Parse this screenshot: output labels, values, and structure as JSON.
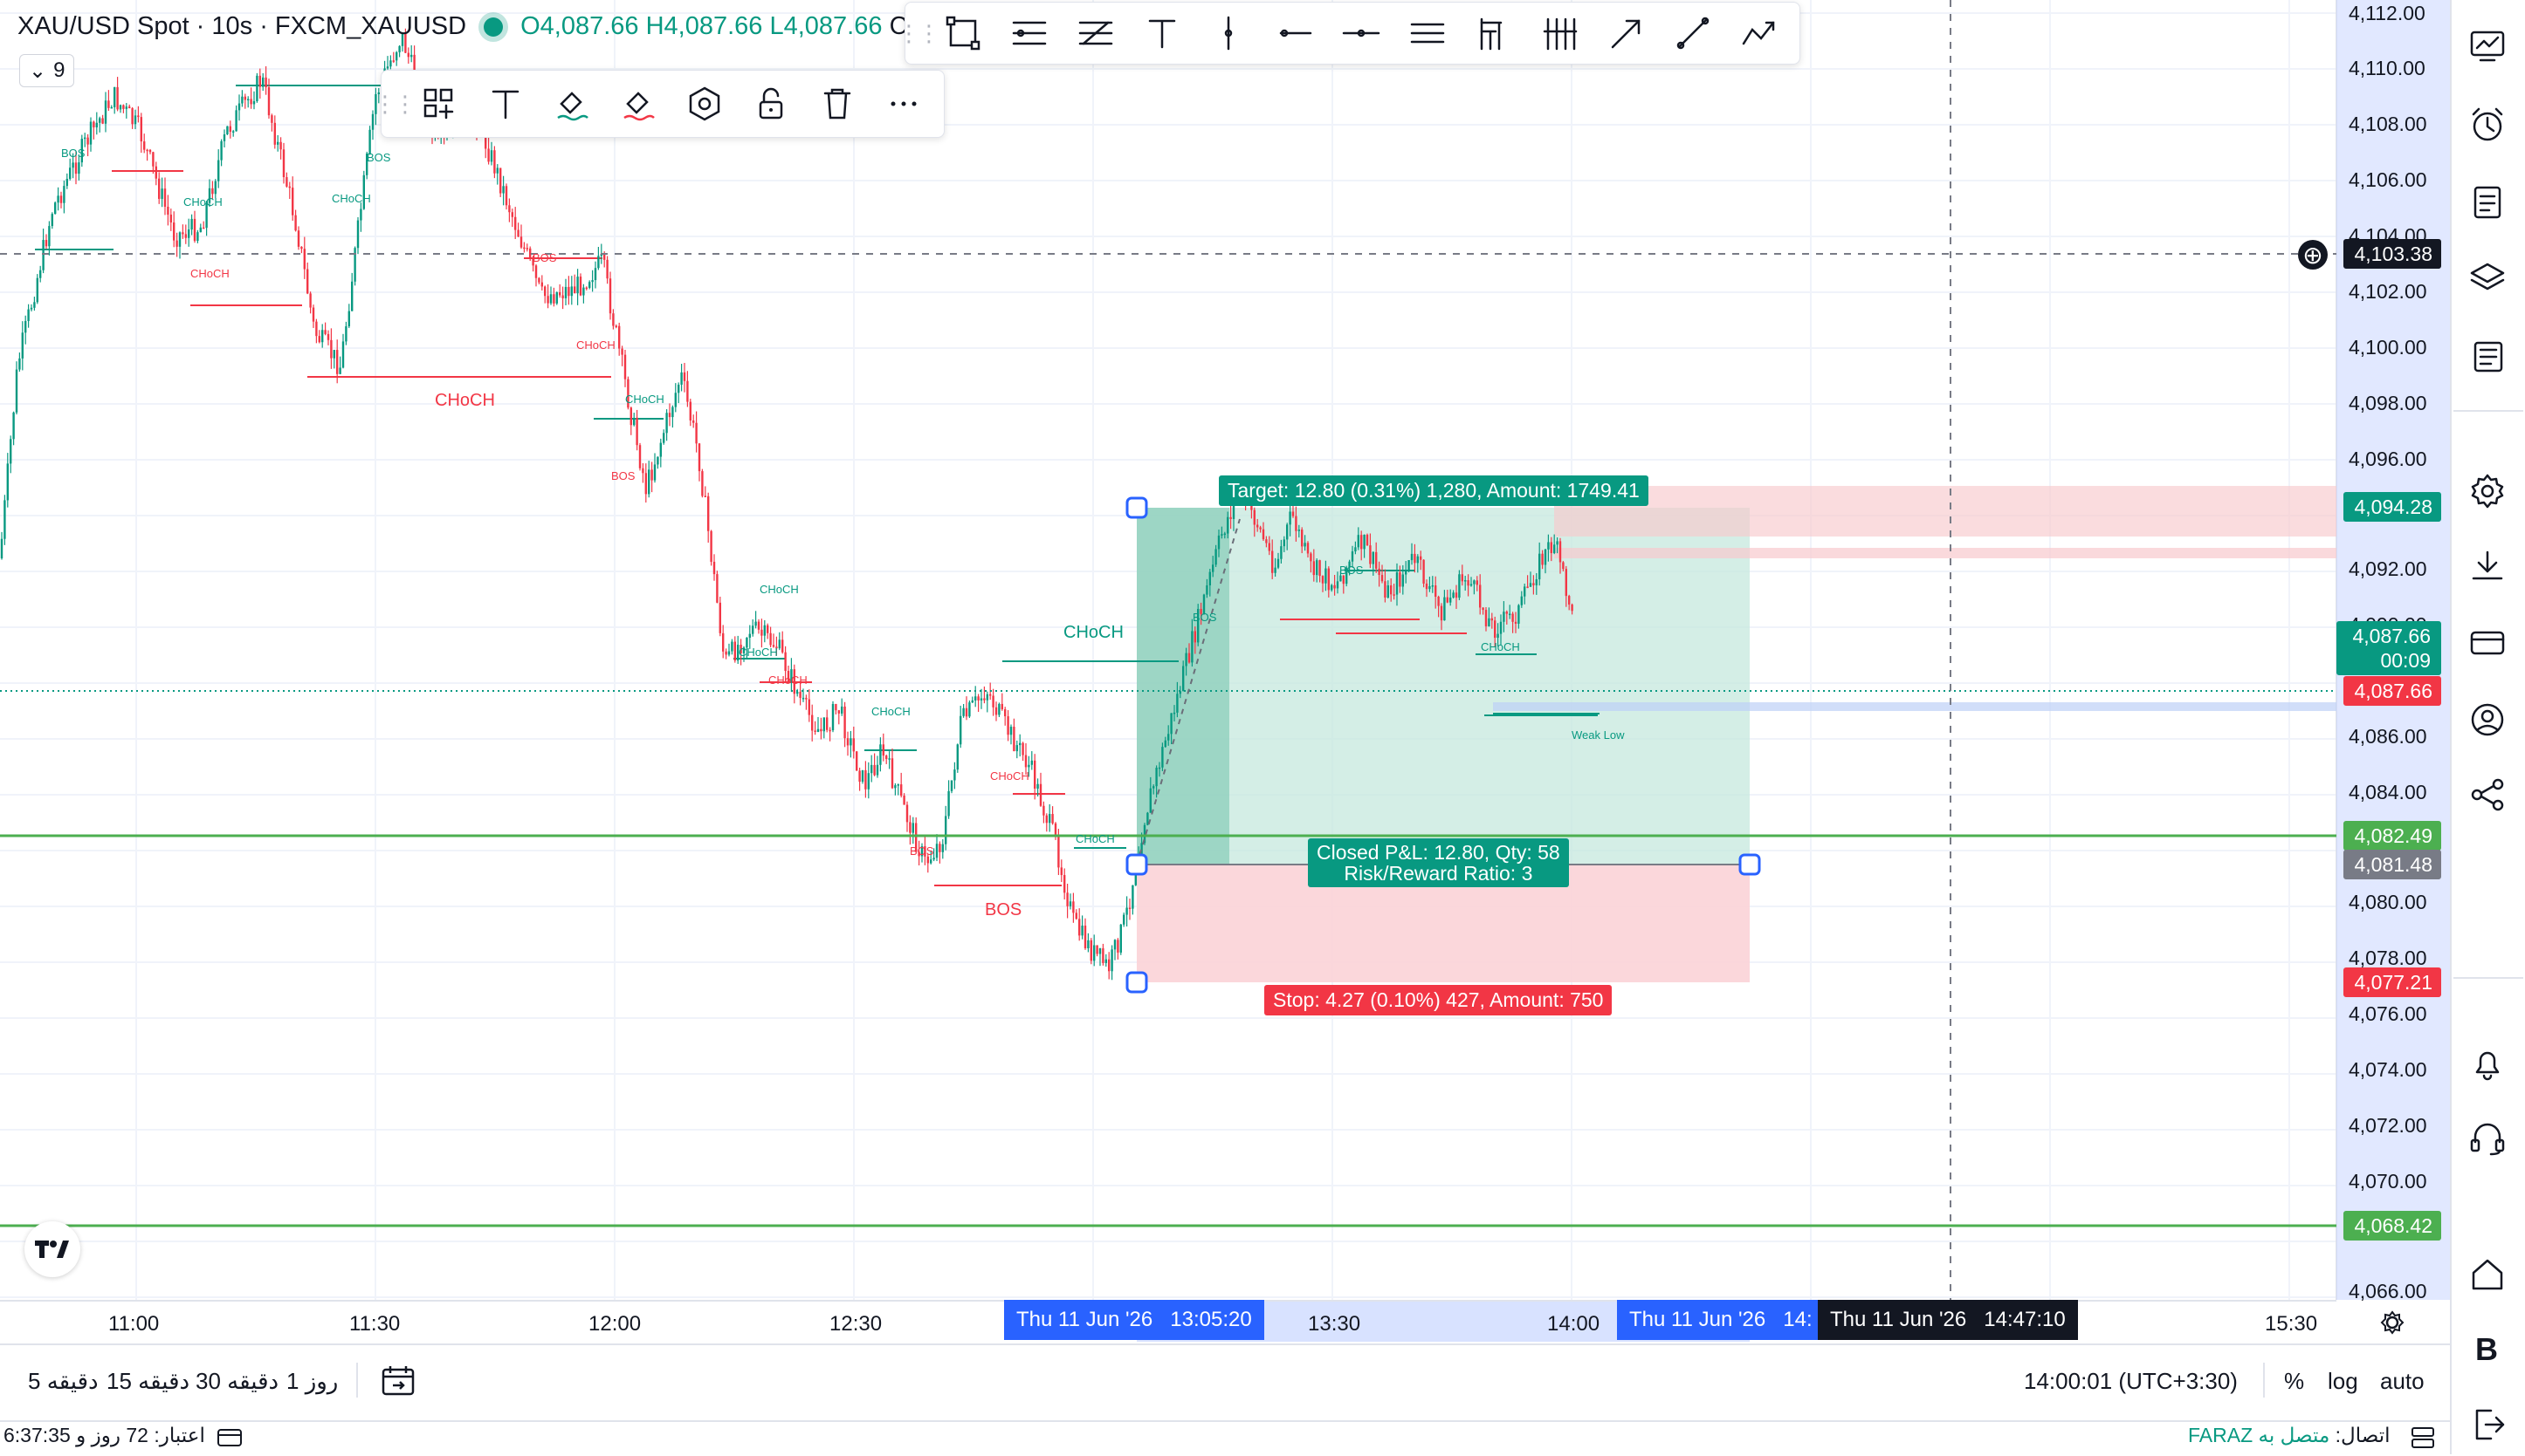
{
  "header": {
    "symbol": "XAU/USD Spot · 10s · FXCM_XAUUSD",
    "open": "O4,087.66",
    "high": "H4,087.66",
    "low": "L4,087.66",
    "close_prefix": "C",
    "indicators_count": "9"
  },
  "colors": {
    "up": "#089981",
    "down": "#f23645",
    "target_zone": "#c5e8de",
    "stop_zone": "#fbd3d7",
    "hline": "#4caf50",
    "range_highlight": "#c8d6ff",
    "blue": "#2962ff"
  },
  "price_axis": {
    "ticks": [
      "4,112.00",
      "4,110.00",
      "4,108.00",
      "4,106.00",
      "4,104.00",
      "4,102.00",
      "4,100.00",
      "4,098.00",
      "4,096.00",
      "4,092.00",
      "4,090.00",
      "4,086.00",
      "4,084.00",
      "4,080.00",
      "4,078.00",
      "4,076.00",
      "4,074.00",
      "4,072.00",
      "4,070.00",
      "4,066.00"
    ],
    "crosshair_price": "4,103.38",
    "target_price": "4,094.28",
    "last_price": "4,087.66",
    "countdown": "00:09",
    "last_price_red": "4,087.66",
    "hline_price": "4,082.49",
    "entry_price": "4,081.48",
    "stop_price": "4,077.21",
    "lower_hline_price": "4,068.42"
  },
  "time_axis": {
    "ticks": [
      "11:00",
      "11:30",
      "12:00",
      "12:30",
      "13:30",
      "14:00",
      "15:30"
    ],
    "start_date": "Thu 11 Jun '26",
    "start_time": "13:05:20",
    "end_date": "Thu 11 Jun '26",
    "end_time_partial": "14:",
    "crosshair_date": "Thu 11 Jun '26",
    "crosshair_time": "14:47:10"
  },
  "position": {
    "target_label": "Target: 12.80 (0.31%) 1,280, Amount: 1749.41",
    "pnl_label": "Closed P&L: 12.80, Qty: 58",
    "rr_label": "Risk/Reward Ratio: 3",
    "stop_label": "Stop: 4.27 (0.10%) 427, Amount: 750"
  },
  "annotations": {
    "choch_red_1": "CHoCH",
    "choch_green_1": "CHoCH",
    "bos_red_1": "BOS",
    "weak_low": "Weak Low",
    "small_labels": [
      "BOS",
      "BOS",
      "CHoCH",
      "CHoCH",
      "CHoCH",
      "BOS",
      "CHoCH",
      "CHoCH",
      "BOS",
      "CHoCH",
      "CHoCH",
      "CHoCH",
      "BOS",
      "CHoCH",
      "CHoCH",
      "BOS",
      "CHoCH",
      "BOS",
      "CHoCH"
    ]
  },
  "timeframes": [
    "5 دقیقه",
    "15 دقیقه",
    "30 دقیقه",
    "1 روز"
  ],
  "bottom": {
    "clock": "14:00:01 (UTC+3:30)",
    "percent": "%",
    "log": "log",
    "auto": "auto"
  },
  "status": {
    "credit": "اعتبار: 72 روز و 6:37:35",
    "connection_label": "اتصال:",
    "connection_value": "متصل به FARAZ"
  },
  "icons": {
    "drawing_toolbar": [
      "rectangle-icon",
      "fib-channel-icon",
      "fib-retracement-icon",
      "text-icon",
      "vertical-line-icon",
      "ray-icon",
      "horizontal-line-icon",
      "parallel-channel-icon",
      "pitchfork-icon",
      "long-position-icon",
      "arrow-icon",
      "trend-line-icon",
      "path-icon"
    ],
    "object_toolbar": [
      "template-icon",
      "text-icon",
      "fill-color-icon",
      "line-color-icon",
      "settings-icon",
      "lock-icon",
      "trash-icon",
      "more-icon"
    ],
    "right_sidebar": [
      "watchlist-icon",
      "alarm-icon",
      "calendar-icon",
      "layers-icon",
      "news-icon",
      "settings-icon",
      "download-icon",
      "wallet-icon",
      "account-icon",
      "share-icon",
      "bell-icon",
      "support-icon",
      "home-icon",
      "broker-b-icon",
      "logout-icon"
    ]
  }
}
